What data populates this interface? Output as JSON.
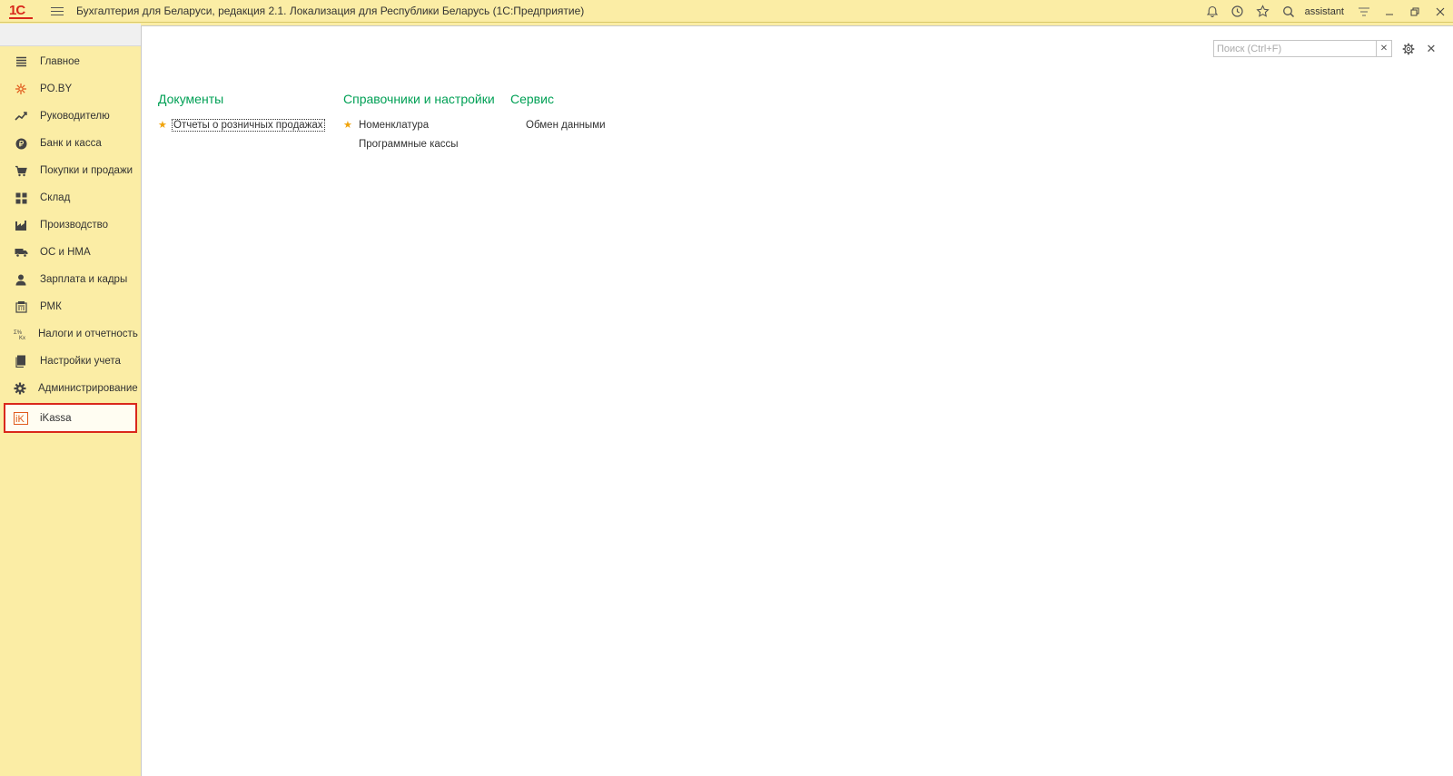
{
  "titlebar": {
    "logo": "1С",
    "title": "Бухгалтерия для Беларуси, редакция 2.1. Локализация для Республики Беларусь   (1С:Предприятие)",
    "user": "assistant",
    "icons": [
      "bell-icon",
      "history-icon",
      "star-icon",
      "search-icon"
    ]
  },
  "sidebar": {
    "items": [
      {
        "label": "Главное",
        "icon": "hamburger-icon"
      },
      {
        "label": "PO.BY",
        "icon": "poby-icon"
      },
      {
        "label": "Руководителю",
        "icon": "trend-icon"
      },
      {
        "label": "Банк и касса",
        "icon": "ruble-icon"
      },
      {
        "label": "Покупки и продажи",
        "icon": "cart-icon"
      },
      {
        "label": "Склад",
        "icon": "warehouse-icon"
      },
      {
        "label": "Производство",
        "icon": "factory-icon"
      },
      {
        "label": "ОС и НМА",
        "icon": "truck-icon"
      },
      {
        "label": "Зарплата и кадры",
        "icon": "person-icon"
      },
      {
        "label": "РМК",
        "icon": "register-icon"
      },
      {
        "label": "Налоги и отчетность",
        "icon": "tax-icon"
      },
      {
        "label": "Настройки учета",
        "icon": "book-icon"
      },
      {
        "label": "Администрирование",
        "icon": "gear-icon"
      },
      {
        "label": "iKassa",
        "icon": "ikassa-icon",
        "selected": true
      }
    ]
  },
  "main": {
    "search": {
      "placeholder": "Поиск (Ctrl+F)",
      "value": ""
    },
    "sections": [
      {
        "title": "Документы",
        "links": [
          {
            "label": "Отчеты о розничных продажах",
            "starred": true,
            "focused": true
          }
        ]
      },
      {
        "title": "Справочники и настройки",
        "links": [
          {
            "label": "Номенклатура",
            "starred": true
          },
          {
            "label": "Программные кассы",
            "starred": false
          }
        ]
      },
      {
        "title": "Сервис",
        "links": [
          {
            "label": "Обмен данными",
            "starred": false
          }
        ]
      }
    ]
  },
  "colors": {
    "background": "#fbeda5",
    "section_title": "#00a055",
    "star": "#f0a30a",
    "selected_border": "#d9281c"
  }
}
